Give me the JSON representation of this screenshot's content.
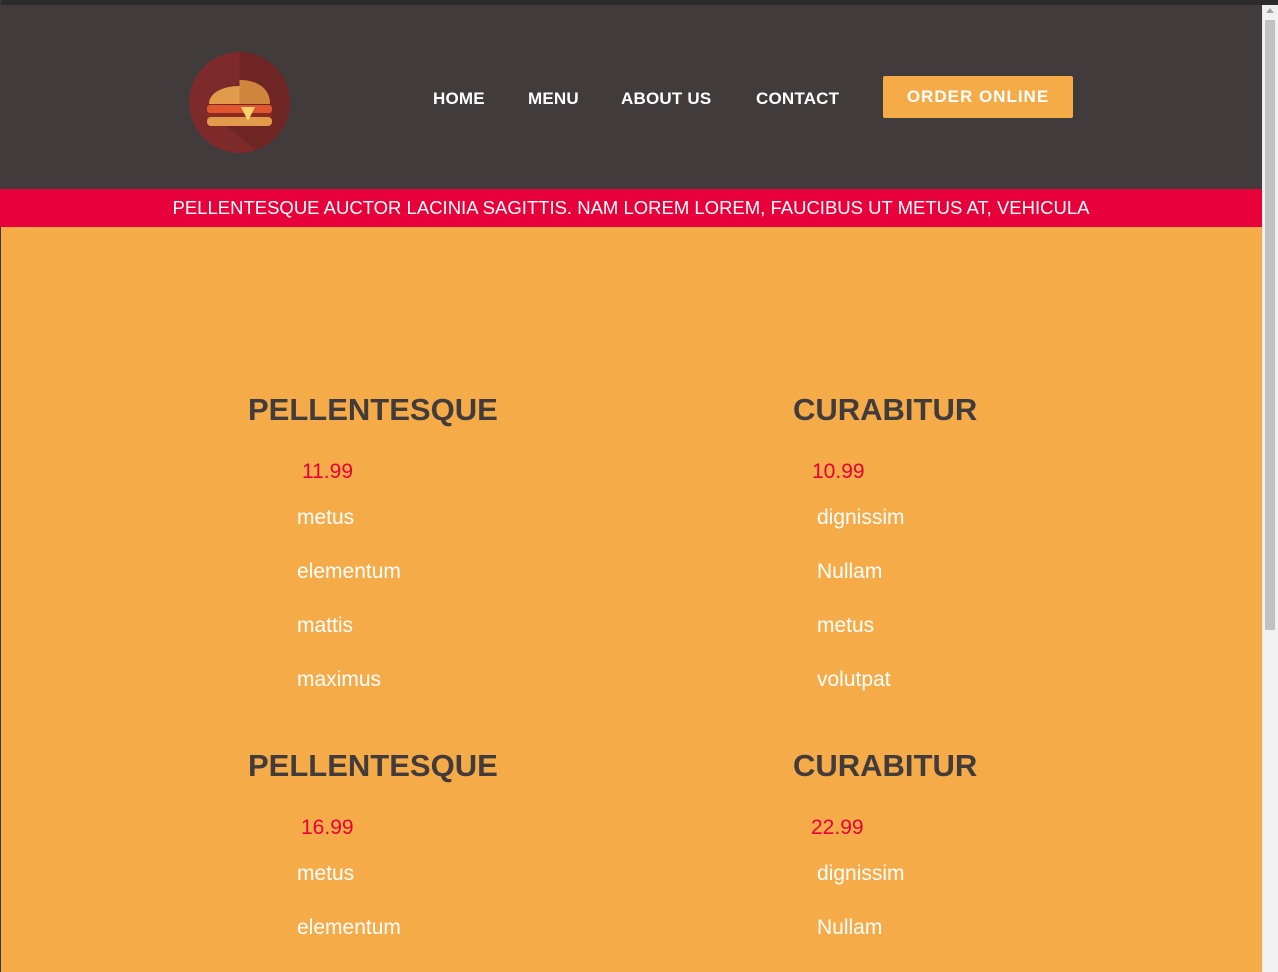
{
  "header": {
    "logo_icon": "burger-icon",
    "nav": {
      "home": "HOME",
      "menu": "MENU",
      "about": "ABOUT US",
      "contact": "CONTACT"
    },
    "order_button": "ORDER ONLINE"
  },
  "banner": {
    "text": "PELLENTESQUE AUCTOR LACINIA SAGITTIS. NAM LOREM LOREM, FAUCIBUS UT METUS AT, VEHICULA"
  },
  "menu_sections": [
    {
      "title": "PELLENTESQUE",
      "price": "11.99",
      "items": [
        "metus",
        "elementum",
        "mattis",
        "maximus"
      ]
    },
    {
      "title": "CURABITUR",
      "price": "10.99",
      "items": [
        "dignissim",
        "Nullam",
        "metus",
        "volutpat"
      ]
    },
    {
      "title": "PELLENTESQUE",
      "price": "16.99",
      "items": [
        "metus",
        "elementum"
      ]
    },
    {
      "title": "CURABITUR",
      "price": "22.99",
      "items": [
        "dignissim",
        "Nullam"
      ]
    }
  ],
  "colors": {
    "header_bg": "#413b3c",
    "banner_bg": "#e8003a",
    "page_bg": "#f5ab48",
    "price": "#e8003a",
    "title": "#413b3c"
  }
}
